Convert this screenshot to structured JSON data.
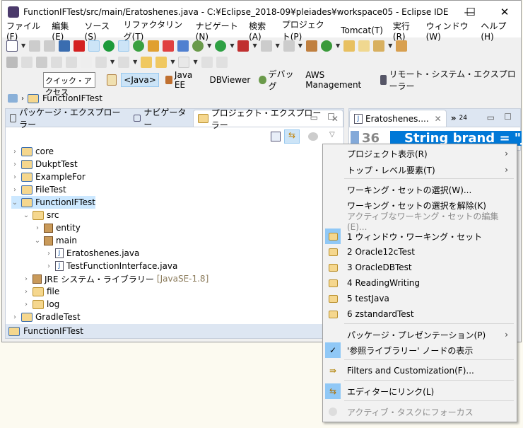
{
  "window": {
    "title": "FunctionIFTest/src/main/Eratoshenes.java - C:¥Eclipse_2018-09¥pleiades¥workspace05 - Eclipse IDE",
    "minimize": "—",
    "maximize": "☐",
    "close": "✕"
  },
  "menubar": [
    "ファイル(F)",
    "編集(E)",
    "ソース(S)",
    "リファクタリング(T)",
    "ナビゲート(N)",
    "検索(A)",
    "プロジェクト(P)",
    "Tomcat(T)",
    "実行(R)",
    "ウィンドウ(W)",
    "ヘルプ(H)"
  ],
  "quick_access": {
    "placeholder": "クイック・アクセス"
  },
  "perspectives": [
    "<Java>",
    "Java EE",
    "DBViewer",
    "デバッグ",
    "AWS Management",
    "リモート・システム・エクスプローラー"
  ],
  "breadcrumb": [
    "FunctionIFTest"
  ],
  "left_view": {
    "tabs": [
      "パッケージ・エクスプローラー",
      "ナビゲーター",
      "プロジェクト・エクスプローラー"
    ],
    "tree": [
      {
        "label": "core",
        "depth": 0,
        "twisty": "›",
        "icon": "project"
      },
      {
        "label": "DukptTest",
        "depth": 0,
        "twisty": "›",
        "icon": "project"
      },
      {
        "label": "ExampleFor",
        "depth": 0,
        "twisty": "›",
        "icon": "project"
      },
      {
        "label": "FileTest",
        "depth": 0,
        "twisty": "›",
        "icon": "project"
      },
      {
        "label": "FunctionIFTest",
        "depth": 0,
        "twisty": "⌄",
        "icon": "project",
        "selected": true
      },
      {
        "label": "src",
        "depth": 1,
        "twisty": "⌄",
        "icon": "srcfolder"
      },
      {
        "label": "entity",
        "depth": 2,
        "twisty": "›",
        "icon": "package"
      },
      {
        "label": "main",
        "depth": 2,
        "twisty": "⌄",
        "icon": "package"
      },
      {
        "label": "Eratoshenes.java",
        "depth": 3,
        "twisty": "›",
        "icon": "java"
      },
      {
        "label": "TestFunctionInterface.java",
        "depth": 3,
        "twisty": "›",
        "icon": "java"
      },
      {
        "label": "JRE システム・ライブラリー",
        "suffix": "[JavaSE-1.8]",
        "depth": 1,
        "twisty": "›",
        "icon": "library"
      },
      {
        "label": "file",
        "depth": 1,
        "twisty": "›",
        "icon": "folder"
      },
      {
        "label": "log",
        "depth": 1,
        "twisty": "›",
        "icon": "folder"
      },
      {
        "label": "GradleTest",
        "depth": 0,
        "twisty": "›",
        "icon": "project"
      }
    ],
    "status": "FunctionIFTest"
  },
  "editor": {
    "tab": "Eratoshenes....",
    "overflow": "»",
    "overflow_count": "24",
    "line_number": "36",
    "code": "String brand = \"J"
  },
  "view_menu": {
    "items": [
      {
        "label": "プロジェクト表示(R)",
        "submenu": true
      },
      {
        "label": "トップ・レベル要素(T)",
        "submenu": true
      },
      {
        "label": "ワーキング・セットの選択(W)..."
      },
      {
        "label": "ワーキング・セットの選択を解除(K)"
      },
      {
        "label": "アクティブなワーキング・セットの編集(E)...",
        "disabled": true
      },
      {
        "label": "1 ウィンドウ・ワーキング・セット",
        "checked": true
      },
      {
        "label": "2 Oracle12cTest"
      },
      {
        "label": "3 OracleDBTest"
      },
      {
        "label": "4 ReadingWriting"
      },
      {
        "label": "5 testJava"
      },
      {
        "label": "6 zstandardTest"
      },
      {
        "label": "パッケージ・プレゼンテーション(P)",
        "submenu": true
      },
      {
        "label": "'参照ライブラリー' ノードの表示",
        "checked": true
      },
      {
        "label": "Filters and Customization(F)..."
      },
      {
        "label": "エディターにリンク(L)",
        "checked": true
      },
      {
        "label": "アクティブ・タスクにフォーカス",
        "disabled": true
      }
    ],
    "check": "✓",
    "arrow": "›"
  },
  "colors": {
    "selection": "#cce8ff",
    "editor_highlight": "#0078d7",
    "menu_check_bg": "#90c8f6"
  }
}
